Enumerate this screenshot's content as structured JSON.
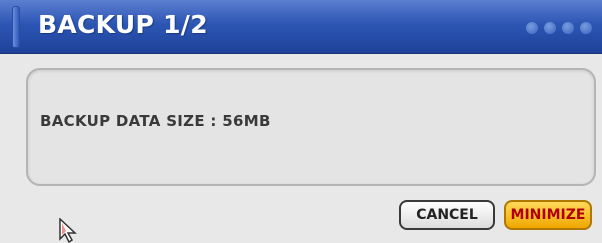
{
  "dialog": {
    "title": "BACKUP 1/2",
    "message": "BACKUP DATA SIZE : 56MB"
  },
  "buttons": {
    "cancel_label": "CANCEL",
    "minimize_label": "MINIMIZE"
  },
  "colors": {
    "titlebar": "#2d56b4",
    "minimize_bg": "#ffc423",
    "minimize_text": "#b00000"
  }
}
